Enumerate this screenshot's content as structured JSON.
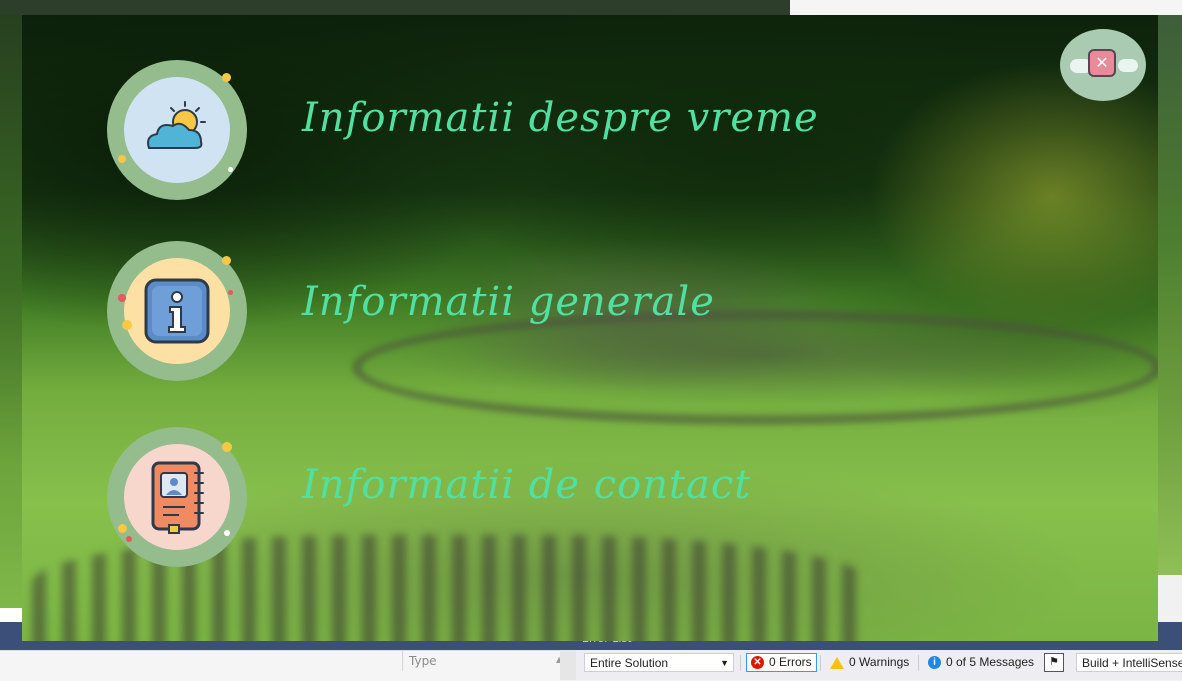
{
  "app": {
    "menu": [
      {
        "label": "Informatii despre vreme",
        "icon": "weather-icon"
      },
      {
        "label": "Informatii generale",
        "icon": "info-icon"
      },
      {
        "label": "Informatii de contact",
        "icon": "contact-book-icon"
      }
    ],
    "close_icon": "close-icon",
    "accent_color": "#4fe0a2"
  },
  "ide": {
    "left_panel_column": "Type",
    "error_list_title": "Error List",
    "scope": "Entire Solution",
    "errors": "0 Errors",
    "warnings": "0 Warnings",
    "messages": "0 of 5 Messages",
    "build_filter": "Build + IntelliSense"
  }
}
